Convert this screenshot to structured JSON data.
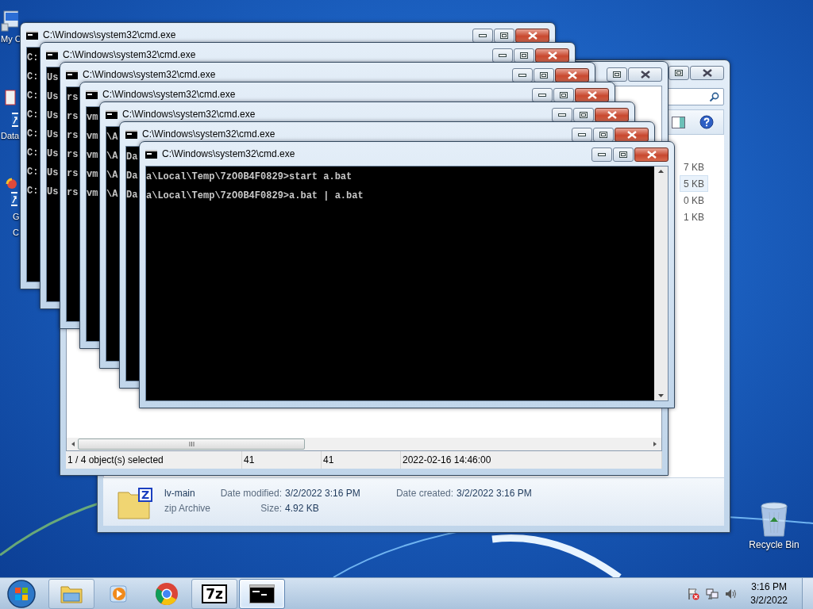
{
  "desktop_icons": [
    {
      "kind": "computer",
      "lines": [
        "My C"
      ]
    },
    {
      "kind": "shortcut",
      "lines": [
        "Data"
      ]
    },
    {
      "kind": "app",
      "lines": [
        "G",
        "C"
      ]
    },
    {
      "kind": "recycle",
      "lines": [
        "Recycle Bin"
      ]
    }
  ],
  "explorer": {
    "file_rows": [
      {
        "size": "7 KB",
        "selected": false
      },
      {
        "size": "5 KB",
        "selected": true
      },
      {
        "size": "0 KB",
        "selected": false
      },
      {
        "size": "1 KB",
        "selected": false
      }
    ],
    "details": {
      "badge": "Z",
      "name": "lv-main",
      "type": "zip Archive",
      "date_modified_label": "Date modified:",
      "date_modified": "3/2/2022 3:16 PM",
      "size_label": "Size:",
      "size": "4.92 KB",
      "date_created_label": "Date created:",
      "date_created": "3/2/2022 3:16 PM"
    }
  },
  "archive_window": {
    "status_bar": [
      "1 / 4 object(s) selected",
      "41",
      "41",
      "2022-02-16 14:46:00"
    ]
  },
  "console_windows": [
    {
      "title": "C:\\Windows\\system32\\cmd.exe",
      "lines": [
        "C:",
        "C:",
        "C:",
        "C:",
        "C:",
        "C:",
        "C:",
        "C:"
      ]
    },
    {
      "title": "C:\\Windows\\system32\\cmd.exe",
      "lines": [
        "Us",
        "Us",
        "Us",
        "Us",
        "Us",
        "Us",
        "Us"
      ]
    },
    {
      "title": "C:\\Windows\\system32\\cmd.exe",
      "lines": [
        "rs",
        "rs",
        "rs",
        "rs",
        "rs",
        "rs"
      ]
    },
    {
      "title": "C:\\Windows\\system32\\cmd.exe",
      "lines": [
        "vm",
        "vm",
        "vm",
        "vm",
        "vm"
      ]
    },
    {
      "title": "C:\\Windows\\system32\\cmd.exe",
      "lines": [
        "\\A",
        "\\A",
        "\\A",
        "\\A"
      ]
    },
    {
      "title": "C:\\Windows\\system32\\cmd.exe",
      "lines": [
        "Da",
        "Da",
        "Da"
      ]
    },
    {
      "title": "C:\\Windows\\system32\\cmd.exe",
      "lines": [
        "a\\Local\\Temp\\7zO0B4F0829>start a.bat",
        "a\\Local\\Temp\\7zO0B4F0829>a.bat | a.bat"
      ]
    }
  ],
  "taskbar": {
    "items": [
      {
        "kind": "explorer",
        "running": true,
        "selected": false
      },
      {
        "kind": "media",
        "running": false,
        "selected": false
      },
      {
        "kind": "browser",
        "running": false,
        "selected": false
      },
      {
        "kind": "archiver",
        "label": "7z",
        "running": true,
        "selected": false
      },
      {
        "kind": "console",
        "running": true,
        "selected": true
      }
    ],
    "clock": {
      "time": "3:16 PM",
      "date": "3/2/2022"
    }
  }
}
